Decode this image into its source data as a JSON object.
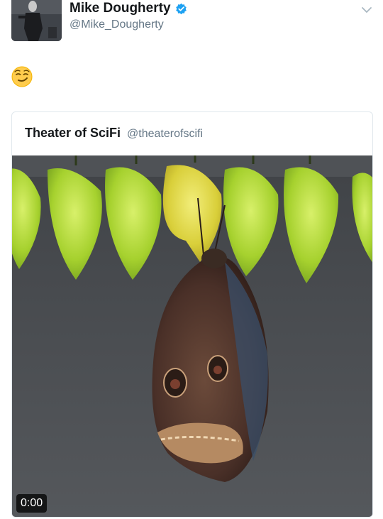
{
  "tweet": {
    "author_name": "Mike Dougherty",
    "author_handle": "@Mike_Dougherty",
    "emoji": "smirk-face",
    "verified_icon": "verified-badge-icon",
    "menu_icon": "chevron-down-icon"
  },
  "quoted": {
    "name": "Theater of SciFi",
    "handle": "@theaterofscifi",
    "video_time": "0:00",
    "media_description": "butterfly-emerging-chrysalis-video"
  },
  "colors": {
    "text_primary": "#14171a",
    "text_secondary": "#657786",
    "verified_blue": "#1da1f2",
    "border": "#e1e8ed"
  }
}
